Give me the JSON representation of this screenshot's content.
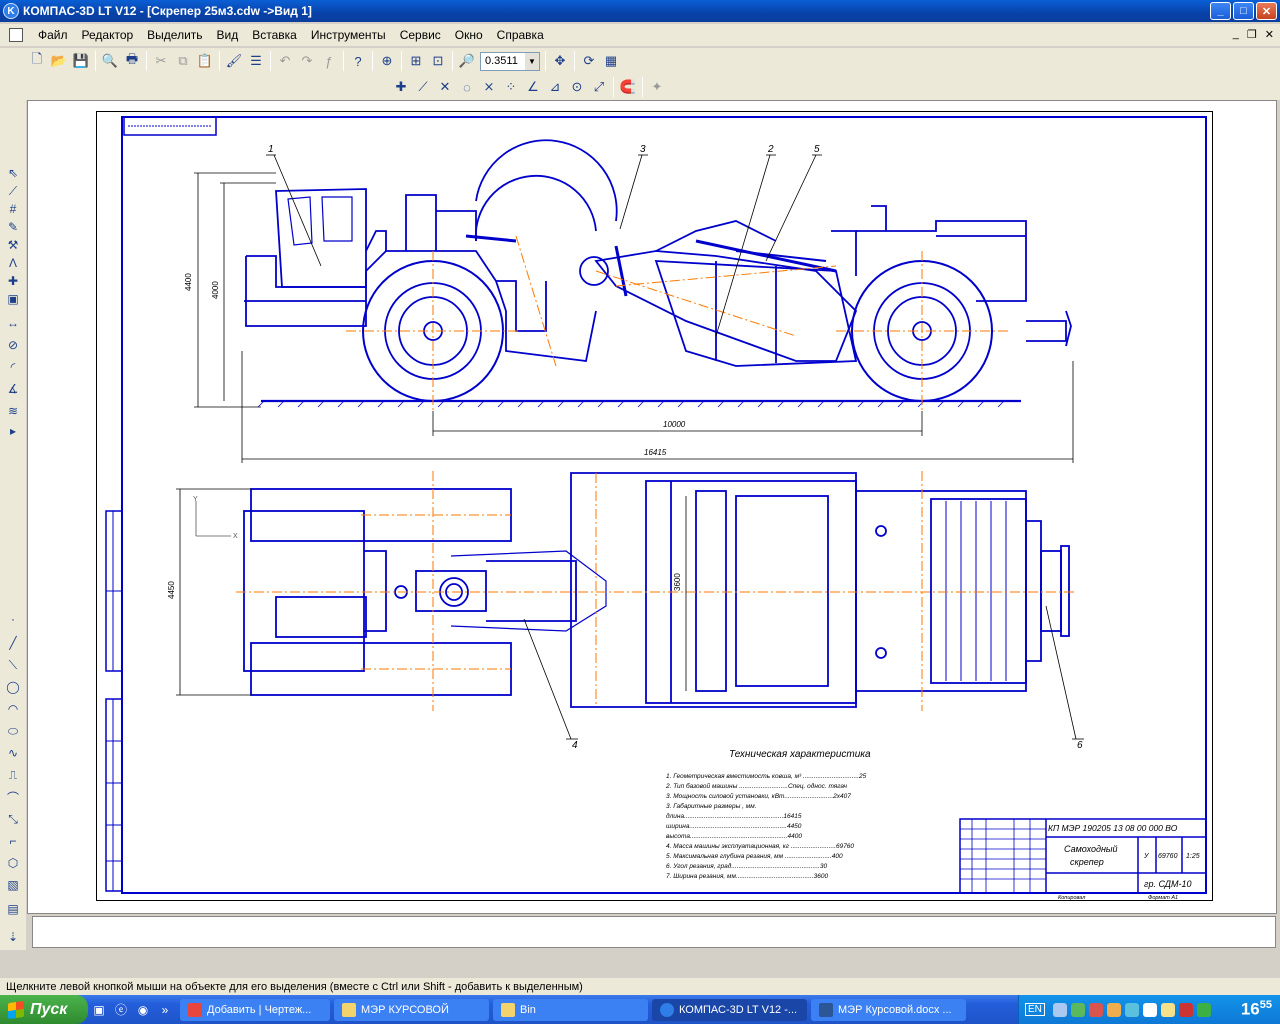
{
  "window": {
    "title": "КОМПАС-3D LT V12 - [Скрепер 25м3.cdw ->Вид 1]",
    "icon": "kompas-icon",
    "buttons": {
      "minimize": "_",
      "maximize": "□",
      "close": "✕"
    }
  },
  "menu": {
    "items": [
      "Файл",
      "Редактор",
      "Выделить",
      "Вид",
      "Вставка",
      "Инструменты",
      "Сервис",
      "Окно",
      "Справка"
    ]
  },
  "toolbar": {
    "zoom_value": "0.3511"
  },
  "drawing": {
    "leaders": [
      "1",
      "3",
      "2",
      "5",
      "4",
      "6"
    ],
    "dimensions": {
      "height_outer": "4400",
      "height_inner": "4000",
      "wheelbase": "10000",
      "length": "16415",
      "width": "4450",
      "bowl_width": "3600"
    },
    "axis_labels": {
      "y": "Y",
      "x": "X"
    },
    "spec_title": "Техническая характеристика",
    "spec_lines": [
      "1. Геометрическая вместимость ковша, м³ ...............................25",
      "2. Тип базовой машины ...........................Спец. однос. тягач",
      "3. Мощность силовой установки, кВт...........................2х407",
      "3. Габаритные размеры , мм.",
      "       длина.......................................................16415",
      "       ширина......................................................4450",
      "       высота......................................................4400",
      "4. Масса машины эксплуатационная, кг .........................69760",
      "5. Максимальная глубина резания, мм ..........................400",
      "6. Угол резания, град.................................................30",
      "7. Ширина резания, мм...........................................3600"
    ],
    "title_block": {
      "designation": "КП МЭР 190205 13 08 00 000 ВО",
      "name_line1": "Самоходный",
      "name_line2": "скрепер",
      "stage": "У",
      "mass": "69760",
      "scale": "1:25",
      "group": "гр. СДМ-10"
    },
    "footer": {
      "copied": "Копировал",
      "format": "Формат  А1"
    }
  },
  "status_bar": {
    "hint": "Щелкните левой кнопкой мыши на объекте для его выделения (вместе с Ctrl или Shift - добавить к выделенным)"
  },
  "taskbar": {
    "start": "Пуск",
    "tasks": [
      "Добавить | Чертеж...",
      "МЭР КУРСОВОЙ",
      "Bin",
      "КОМПАС-3D LT V12 -...",
      "МЭР Курсовой.docx ..."
    ],
    "active_task_index": 3,
    "language": "EN",
    "clock_hour": "16",
    "clock_min": "55"
  },
  "colors": {
    "drawing_line": "#0000cc",
    "axis_line": "#ff7a00",
    "background": "#ffffff",
    "chrome": "#ece9d8",
    "taskbar": "#245edb"
  }
}
